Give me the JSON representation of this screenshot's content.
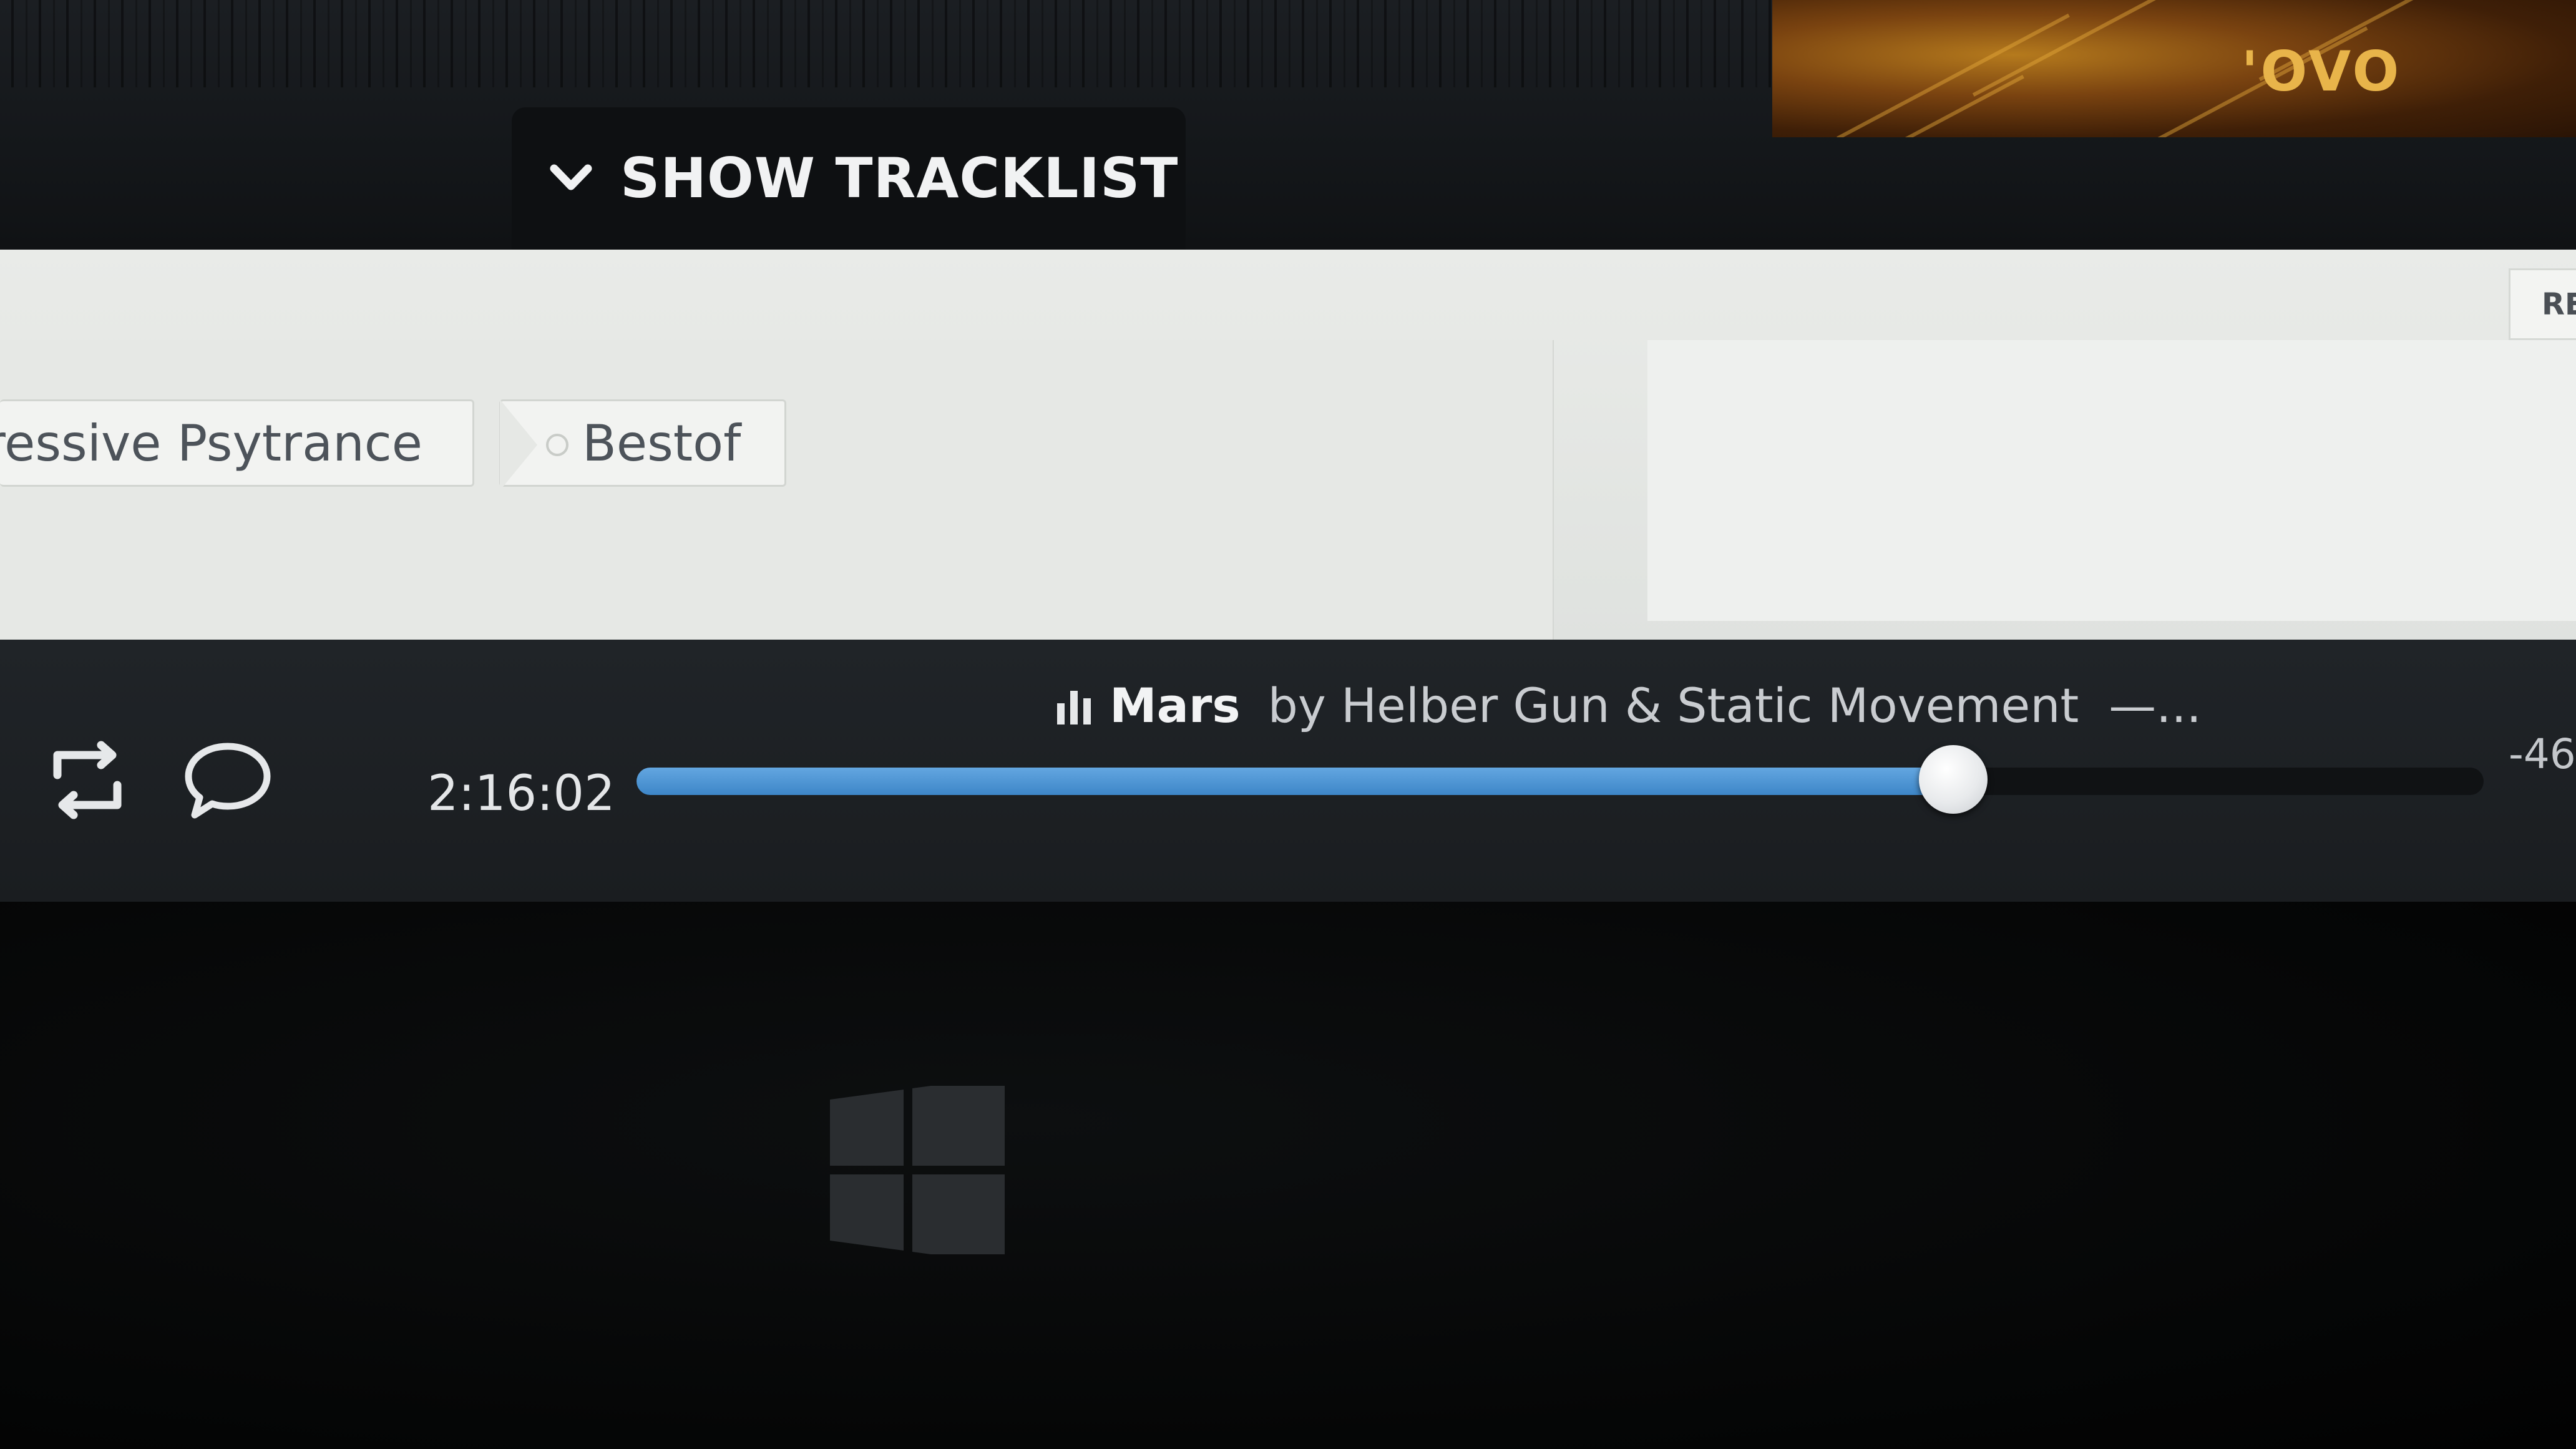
{
  "header": {
    "tracklist_label": "SHOW TRACKLIST",
    "cover_logo": "'OVO"
  },
  "tags": [
    {
      "label": "gressive Psytrance"
    },
    {
      "label": "Bestof"
    }
  ],
  "side_panel": {
    "button_label": "RE"
  },
  "player": {
    "track_title": "Mars",
    "track_artist": "by Helber Gun & Static Movement",
    "track_ellipsis": "—...",
    "elapsed_time": "2:16:02",
    "remaining_time": "-46",
    "progress_percent": 71.3,
    "accent_color": "#4a90d0"
  },
  "icons": {
    "chevron": "chevron-down-icon",
    "equalizer": "equalizer-icon",
    "repost": "repost-icon",
    "comment": "comment-icon",
    "windows": "windows-logo-icon"
  }
}
